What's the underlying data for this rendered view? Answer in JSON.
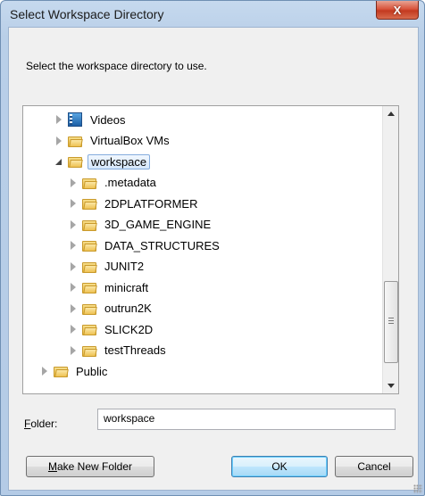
{
  "window": {
    "title": "Select Workspace Directory",
    "close_glyph": "X"
  },
  "prompt": "Select the workspace directory to use.",
  "tree": {
    "items": [
      {
        "label": "Videos",
        "icon": "video-library-icon",
        "state": "collapsed",
        "depth": 1,
        "selected": false
      },
      {
        "label": "VirtualBox VMs",
        "icon": "folder-icon",
        "state": "collapsed",
        "depth": 1,
        "selected": false
      },
      {
        "label": "workspace",
        "icon": "folder-icon",
        "state": "expanded",
        "depth": 1,
        "selected": true
      },
      {
        "label": ".metadata",
        "icon": "folder-icon",
        "state": "collapsed",
        "depth": 2,
        "selected": false
      },
      {
        "label": "2DPLATFORMER",
        "icon": "folder-icon",
        "state": "collapsed",
        "depth": 2,
        "selected": false
      },
      {
        "label": "3D_GAME_ENGINE",
        "icon": "folder-icon",
        "state": "collapsed",
        "depth": 2,
        "selected": false
      },
      {
        "label": "DATA_STRUCTURES",
        "icon": "folder-icon",
        "state": "collapsed",
        "depth": 2,
        "selected": false
      },
      {
        "label": "JUNIT2",
        "icon": "folder-icon",
        "state": "collapsed",
        "depth": 2,
        "selected": false
      },
      {
        "label": "minicraft",
        "icon": "folder-icon",
        "state": "collapsed",
        "depth": 2,
        "selected": false
      },
      {
        "label": "outrun2K",
        "icon": "folder-icon",
        "state": "collapsed",
        "depth": 2,
        "selected": false
      },
      {
        "label": "SLICK2D",
        "icon": "folder-icon",
        "state": "collapsed",
        "depth": 2,
        "selected": false
      },
      {
        "label": "testThreads",
        "icon": "folder-icon",
        "state": "collapsed",
        "depth": 2,
        "selected": false
      },
      {
        "label": "Public",
        "icon": "folder-icon",
        "state": "collapsed",
        "depth": 0,
        "selected": false
      }
    ]
  },
  "folder": {
    "label_prefix": "",
    "label_accel": "F",
    "label_rest": "older:",
    "value": "workspace"
  },
  "buttons": {
    "make_new_folder_accel": "M",
    "make_new_folder_rest": "ake New Folder",
    "ok": "OK",
    "cancel": "Cancel"
  }
}
